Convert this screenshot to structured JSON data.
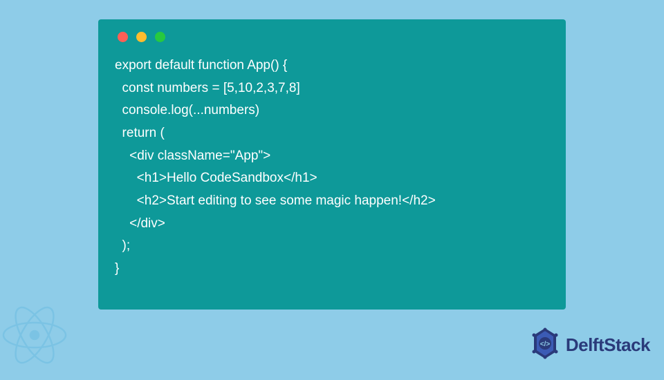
{
  "code": {
    "lines": [
      "export default function App() {",
      "  const numbers = [5,10,2,3,7,8]",
      "  console.log(...numbers)",
      "  return (",
      "    <div className=\"App\">",
      "      <h1>Hello CodeSandbox</h1>",
      "      <h2>Start editing to see some magic happen!</h2>",
      "    </div>",
      "  );",
      "}"
    ]
  },
  "watermark": {
    "brand": "DelftStack"
  },
  "colors": {
    "background": "#8ecce8",
    "window": "#0e9999",
    "text": "#ffffff",
    "brand": "#2a3a7a",
    "dotRed": "#ff5f56",
    "dotYellow": "#ffbd2e",
    "dotGreen": "#27c93f"
  }
}
